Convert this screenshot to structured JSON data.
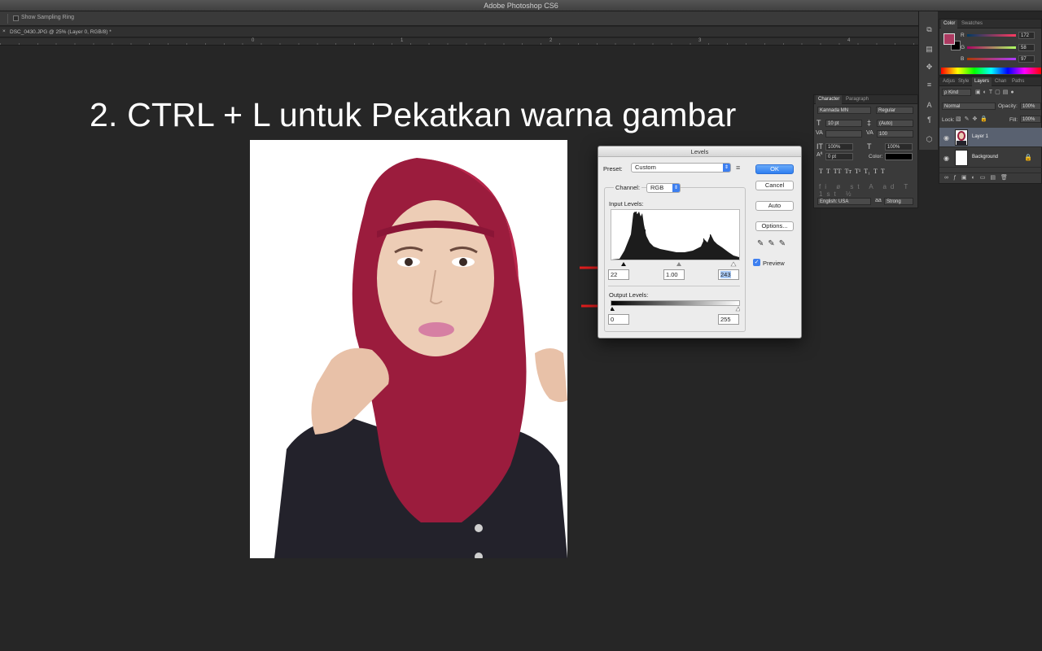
{
  "app": {
    "title": "Adobe Photoshop CS6"
  },
  "options_bar": {
    "sampling_label": "Show Sampling Ring"
  },
  "document": {
    "close": "×",
    "tab_name": "DSC_0430.JPG @ 25% (Layer 0, RGB/8) *"
  },
  "ruler": {
    "labels": [
      "0",
      "1",
      "2",
      "3",
      "4"
    ]
  },
  "headline": "2. CTRL + L untuk Pekatkan warna gambar",
  "levels": {
    "title": "Levels",
    "preset_label": "Preset:",
    "preset_value": "Custom",
    "channel_label": "Channel:",
    "channel_value": "RGB",
    "input_label": "Input Levels:",
    "input_black": "22",
    "input_gamma": "1.00",
    "input_white": "243",
    "output_label": "Output Levels:",
    "output_black": "0",
    "output_white": "255",
    "ok": "OK",
    "cancel": "Cancel",
    "auto": "Auto",
    "options": "Options...",
    "preview_label": "Preview",
    "preview_checked": true
  },
  "color_panel": {
    "tabs": [
      "Color",
      "Swatches"
    ],
    "r_label": "R",
    "r_value": "172",
    "g_label": "G",
    "g_value": "58",
    "b_label": "B",
    "b_value": "97",
    "foreground": "#ac3a61"
  },
  "adjust_panel": {
    "tabs": [
      "Adjus",
      "Style",
      "Layers",
      "Chan",
      "Paths"
    ]
  },
  "layers_panel": {
    "kind_label": "ρ Kind",
    "blend_mode": "Normal",
    "opacity_label": "Opacity:",
    "opacity_value": "100%",
    "lock_label": "Lock:",
    "fill_label": "Fill:",
    "fill_value": "100%",
    "layers": [
      {
        "name": "Layer 1",
        "selected": true
      },
      {
        "name": "Background",
        "selected": false
      }
    ]
  },
  "character_panel": {
    "tabs": [
      "Character",
      "Paragraph"
    ],
    "font": "Kannada MN",
    "style": "Regular",
    "size": "10 pt",
    "leading": "(Auto)",
    "tracking": "100",
    "vscale": "100%",
    "hscale": "100%",
    "baseline": "0 pt",
    "color_label": "Color:",
    "type_buttons": [
      "T",
      "T",
      "TT",
      "Tт",
      "T¹",
      "T₁",
      "T",
      "T"
    ],
    "language": "English: USA",
    "antialias": "Strong"
  }
}
